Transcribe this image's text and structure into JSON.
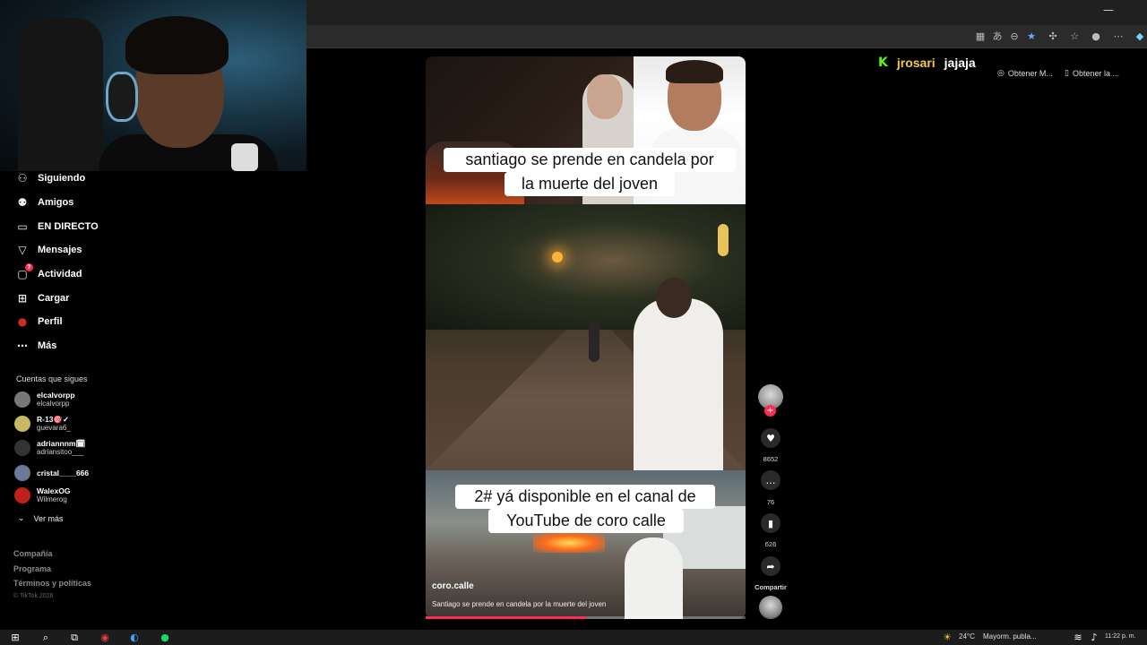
{
  "browser": {
    "minimize": "—",
    "toolbar_icons": [
      "grid-icon",
      "translate-icon",
      "zoom-icon",
      "star-icon",
      "extensions-icon",
      "favorites-icon",
      "profile-icon",
      "menu-icon",
      "copilot-icon"
    ],
    "ext_buttons": [
      {
        "label": "Obtener M..."
      },
      {
        "label": "Obtener la ..."
      }
    ]
  },
  "chat": {
    "badge": "K",
    "username": "jrosari",
    "message": "jajaja"
  },
  "sidebar": {
    "items": [
      {
        "label": "Siguiendo",
        "icon": "person-follow-icon"
      },
      {
        "label": "Amigos",
        "icon": "friends-icon"
      },
      {
        "label": "EN DIRECTO",
        "icon": "live-icon"
      },
      {
        "label": "Mensajes",
        "icon": "messages-icon"
      },
      {
        "label": "Actividad",
        "icon": "activity-icon",
        "badge": "7"
      },
      {
        "label": "Cargar",
        "icon": "upload-icon"
      },
      {
        "label": "Perfil",
        "icon": "profile-icon"
      },
      {
        "label": "Más",
        "icon": "more-icon"
      }
    ],
    "following_title": "Cuentas que sigues",
    "following": [
      {
        "name": "elcalvorpp",
        "handle": "elcalvorpp",
        "color": "#777777"
      },
      {
        "name": "R-13🎯✓",
        "handle": "guevara6_",
        "color": "#c8b860"
      },
      {
        "name": "adriannnm🗓",
        "handle": "adriansitoo___",
        "color": "#333333"
      },
      {
        "name": "cristal____666",
        "handle": "",
        "color": "#6a7a9a"
      },
      {
        "name": "WalexOG",
        "handle": "Wilmerog",
        "color": "#c0201a"
      }
    ],
    "see_more": "Ver más",
    "footer": [
      "Compañía",
      "Programa",
      "Términos y políticas"
    ],
    "copyright": "© TikTok 2026"
  },
  "video": {
    "caption_top_line1": "santiago se prende en candela por",
    "caption_top_line2": "la muerte del joven",
    "caption_bottom_line1": "2# yá disponible en el canal de",
    "caption_bottom_line2": "YouTube de coro calle",
    "author": "coro.calle",
    "description": "Santiago se prende en candela por la muerte del joven",
    "progress": 0.5
  },
  "actions": {
    "likes": "8652",
    "comments": "76",
    "saves": "626",
    "share": "Compartir"
  },
  "taskbar": {
    "weather": "24°C",
    "news": "Mayorm. publa...",
    "time": "11:22 p. m."
  }
}
